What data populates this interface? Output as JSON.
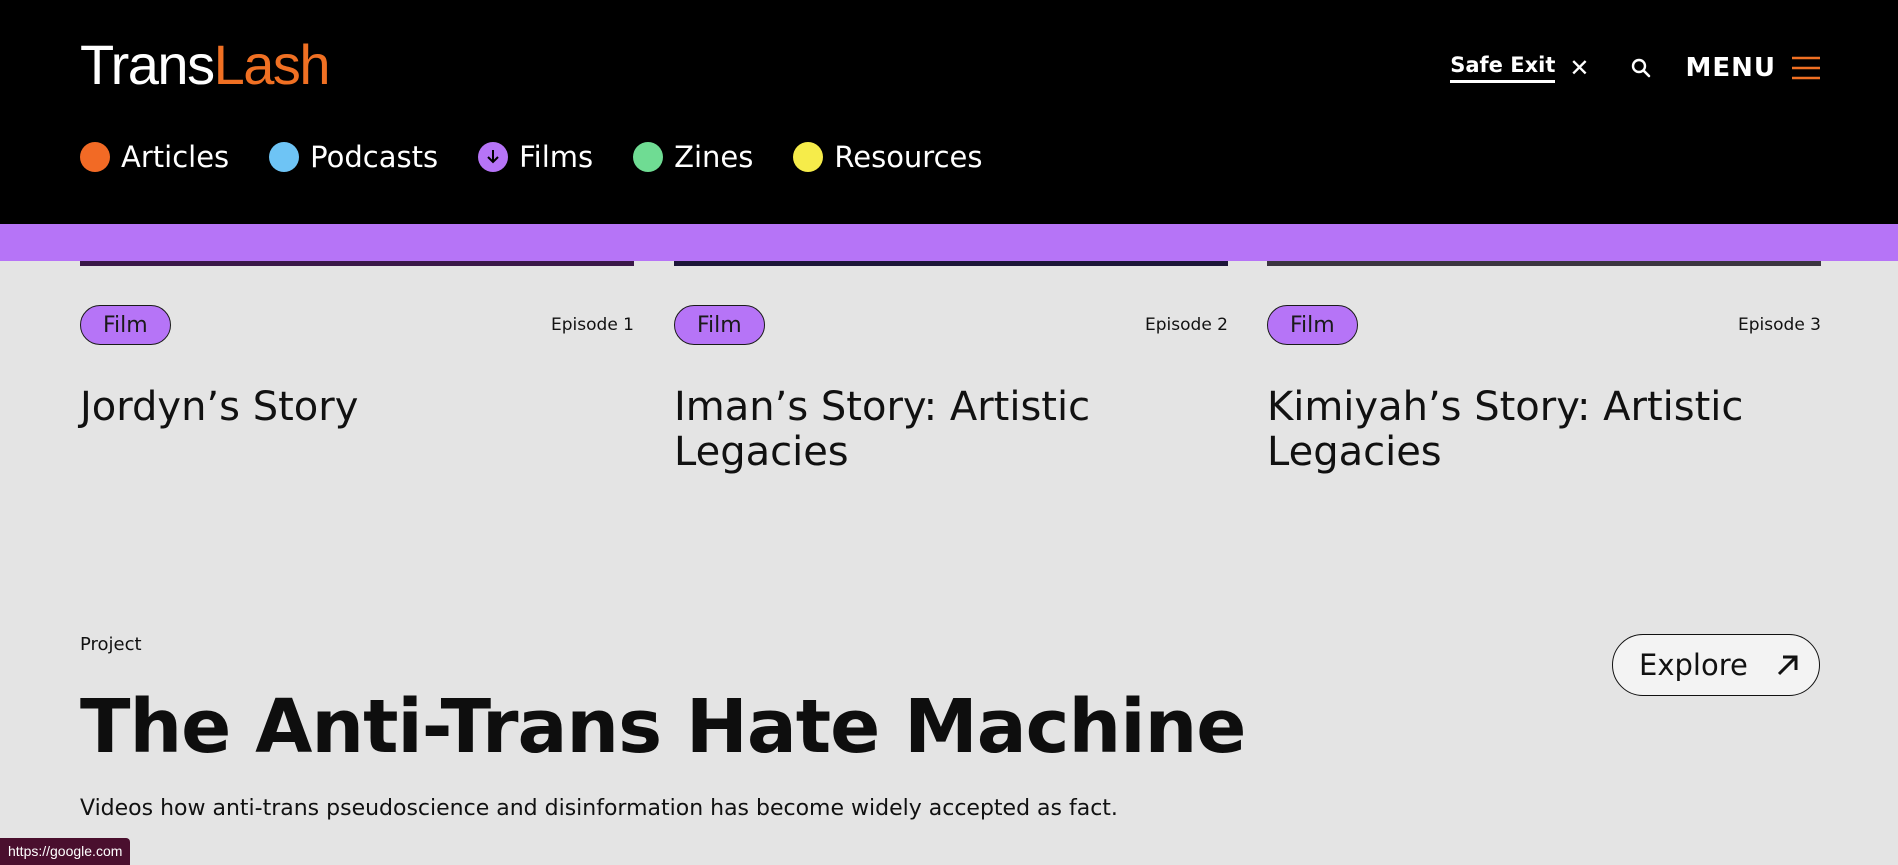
{
  "header": {
    "logo_part1": "Trans",
    "logo_part2": "Lash",
    "safe_exit": "Safe Exit",
    "menu": "MENU"
  },
  "categories": [
    {
      "label": "Articles",
      "color": "#f26a25"
    },
    {
      "label": "Podcasts",
      "color": "#6ec4f5"
    },
    {
      "label": "Films",
      "color": "#b674f7"
    },
    {
      "label": "Zines",
      "color": "#6fdc93"
    },
    {
      "label": "Resources",
      "color": "#f6ec4a"
    }
  ],
  "accent_bar_color": "#b674f7",
  "cards": [
    {
      "tag": "Film",
      "episode": "Episode 1",
      "title": "Jordyn’s Story"
    },
    {
      "tag": "Film",
      "episode": "Episode 2",
      "title": "Iman’s Story: Artistic Legacies"
    },
    {
      "tag": "Film",
      "episode": "Episode 3",
      "title": "Kimiyah’s Story: Artistic Legacies"
    }
  ],
  "project": {
    "label": "Project",
    "title": "The Anti-Trans Hate Machine",
    "description": "Videos how anti-trans pseudoscience and disinformation has become widely accepted as fact.",
    "explore": "Explore"
  },
  "status_bar": {
    "url": "https://google.com"
  }
}
